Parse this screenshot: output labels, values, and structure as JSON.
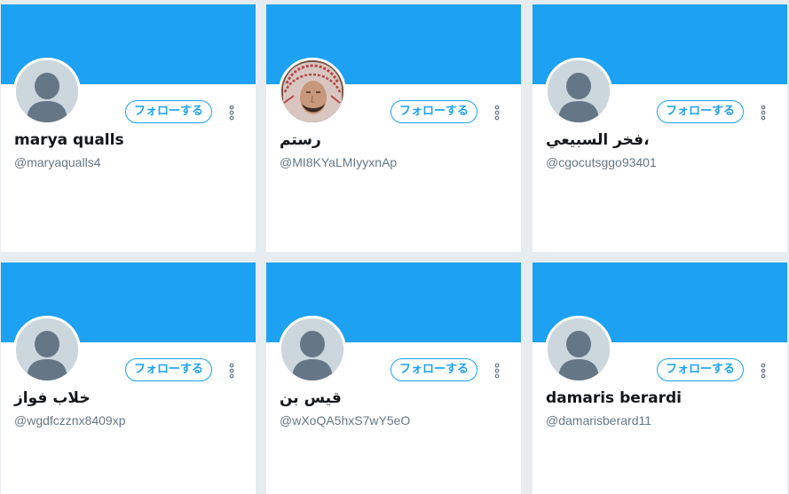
{
  "theme": {
    "accent": "#1da1f2",
    "background": "#e6ecf0",
    "card_background": "#ffffff",
    "placeholder_avatar": "#ccd6dd",
    "placeholder_silhouette": "#657786",
    "name_color": "#14171a",
    "handle_color": "#657786"
  },
  "cards": [
    {
      "name": "marya qualls",
      "handle": "@maryaqualls4",
      "follow_label": "フォローする",
      "avatar": "default-avatar-icon",
      "more_icon": "vertical-ellipsis-icon"
    },
    {
      "name": "رستم",
      "handle": "@MI8KYaLMIyyxnAp",
      "follow_label": "フォローする",
      "avatar": "profile-photo",
      "more_icon": "vertical-ellipsis-icon"
    },
    {
      "name": "فخر السبيعي،",
      "handle": "@cgocutsggo93401",
      "follow_label": "フォローする",
      "avatar": "default-avatar-icon",
      "more_icon": "vertical-ellipsis-icon"
    },
    {
      "name": "خلاب فواز",
      "handle": "@wgdfczznx8409xp",
      "follow_label": "フォローする",
      "avatar": "default-avatar-icon",
      "more_icon": "vertical-ellipsis-icon"
    },
    {
      "name": "قيس بن",
      "handle": "@wXoQA5hxS7wY5eO",
      "follow_label": "フォローする",
      "avatar": "default-avatar-icon",
      "more_icon": "vertical-ellipsis-icon"
    },
    {
      "name": "damaris berardi",
      "handle": "@damarisberard11",
      "follow_label": "フォローする",
      "avatar": "default-avatar-icon",
      "more_icon": "vertical-ellipsis-icon"
    }
  ]
}
